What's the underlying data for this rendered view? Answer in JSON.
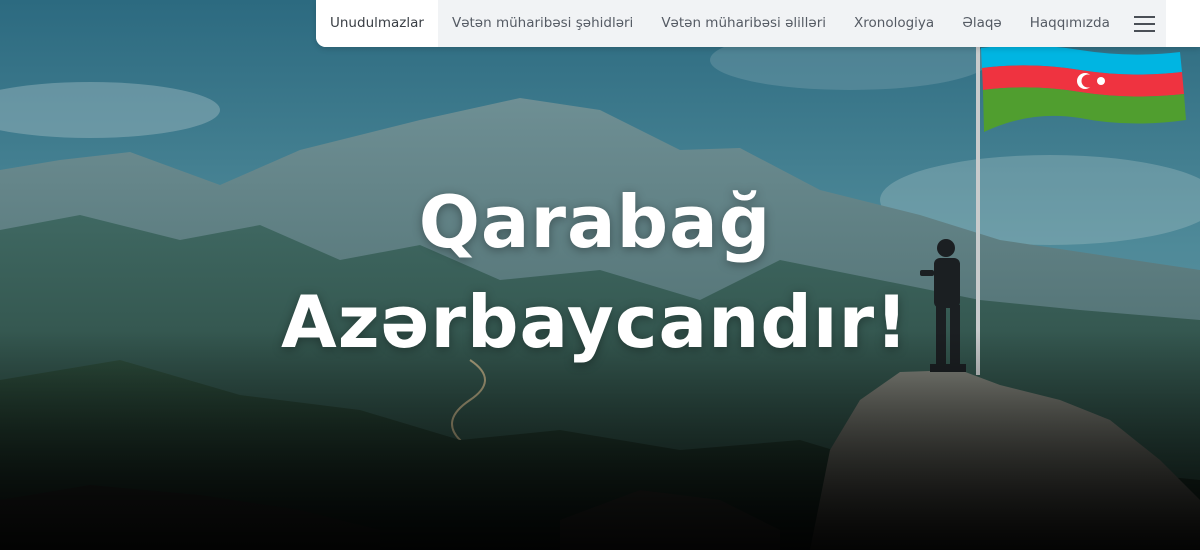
{
  "nav": {
    "items": [
      {
        "label": "Unudulmazlar",
        "active": true
      },
      {
        "label": "Vətən müharibəsi şəhidləri",
        "active": false
      },
      {
        "label": "Vətən müharibəsi əlilləri",
        "active": false
      },
      {
        "label": "Xronologiya",
        "active": false
      },
      {
        "label": "Əlaqə",
        "active": false
      },
      {
        "label": "Haqqımızda",
        "active": false
      }
    ],
    "menu_icon": "hamburger-menu-icon"
  },
  "hero": {
    "headline_line1": "Qarabağ",
    "headline_line2": "Azərbaycandır!"
  },
  "colors": {
    "sky": "#2f6f86",
    "mountain": "#3c5a60",
    "flag_blue": "#00b5e2",
    "flag_red": "#ef3340",
    "flag_green": "#509e2f"
  }
}
